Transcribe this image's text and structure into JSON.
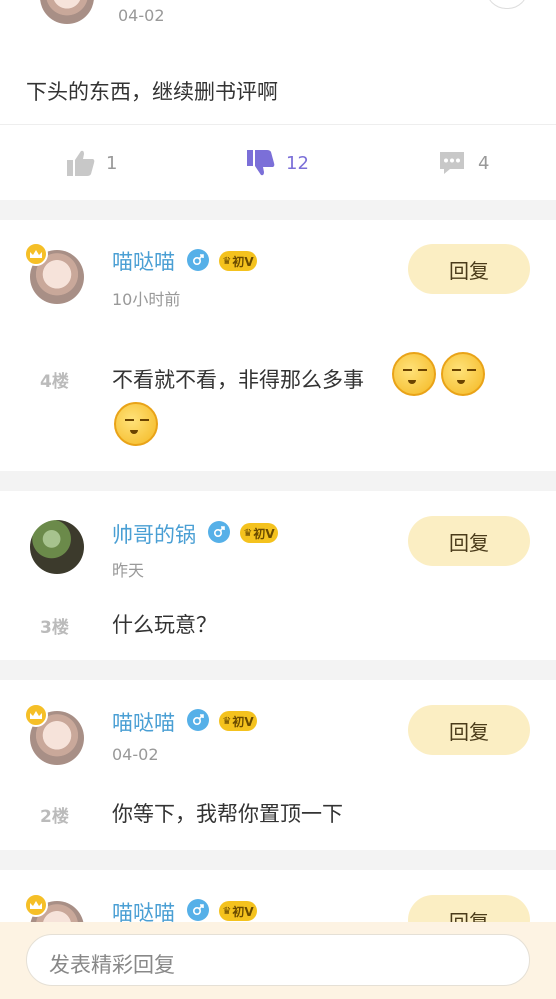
{
  "top_post": {
    "date": "04-02",
    "content": "下头的东西，继续删书评啊",
    "likes": "1",
    "dislikes": "12",
    "comments": "4"
  },
  "replies": [
    {
      "username": "喵哒喵",
      "badge": "初V",
      "time": "10小时前",
      "floor": "4楼",
      "content": "不看就不看，非得那么多事",
      "reply_label": "回复"
    },
    {
      "username": "帅哥的锅",
      "badge": "初V",
      "time": "昨天",
      "floor": "3楼",
      "content": "什么玩意？",
      "reply_label": "回复"
    },
    {
      "username": "喵哒喵",
      "badge": "初V",
      "time": "04-02",
      "floor": "2楼",
      "content": "你等下，我帮你置顶一下",
      "reply_label": "回复"
    },
    {
      "username": "喵哒喵",
      "badge": "初V",
      "reply_label": "回复"
    }
  ],
  "composer": {
    "placeholder": "发表精彩回复"
  },
  "colors": {
    "accent_blue": "#4a9fd4",
    "dislike_active": "#7b6fd8",
    "reply_button_bg": "#fbeec3",
    "vip_badge": "#f4c21e"
  },
  "icons": [
    "thumb-up-icon",
    "thumb-down-icon",
    "comment-icon",
    "male-icon",
    "crown-icon",
    "vip-crown-icon",
    "emoji-icon"
  ]
}
